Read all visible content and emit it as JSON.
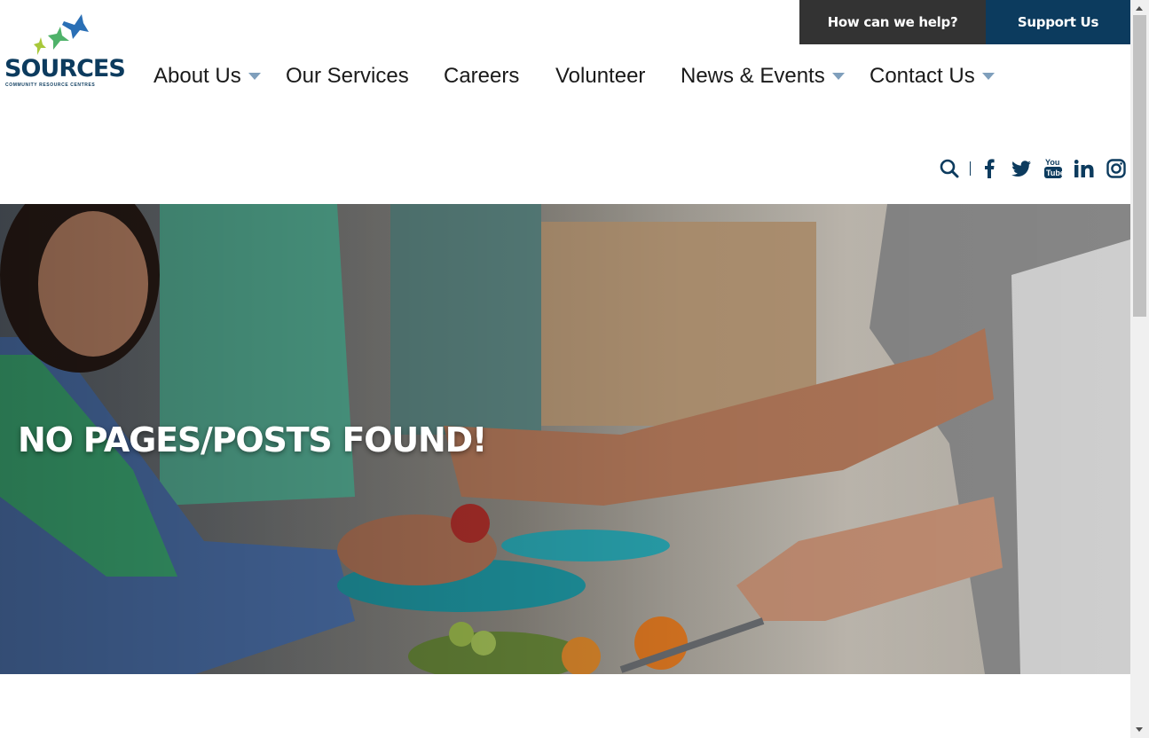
{
  "topbar": {
    "help_label": "How can we help?",
    "support_label": "Support Us"
  },
  "logo": {
    "name": "SOURCES",
    "tagline": "COMMUNITY RESOURCE CENTRES"
  },
  "nav": {
    "items": [
      {
        "label": "About Us",
        "has_dropdown": true
      },
      {
        "label": "Our Services",
        "has_dropdown": false
      },
      {
        "label": "Careers",
        "has_dropdown": false
      },
      {
        "label": "Volunteer",
        "has_dropdown": false
      },
      {
        "label": "News & Events",
        "has_dropdown": true
      },
      {
        "label": "Contact Us",
        "has_dropdown": true
      }
    ]
  },
  "social": {
    "icons": [
      "search-icon",
      "facebook-icon",
      "twitter-icon",
      "youtube-icon",
      "linkedin-icon",
      "instagram-icon"
    ],
    "color": "#0c3b5e"
  },
  "hero": {
    "title": "NO PAGES/POSTS FOUND!"
  },
  "colors": {
    "brand_navy": "#0c3b5e",
    "dark_gray": "#333333",
    "caret": "#7f9fbc"
  }
}
